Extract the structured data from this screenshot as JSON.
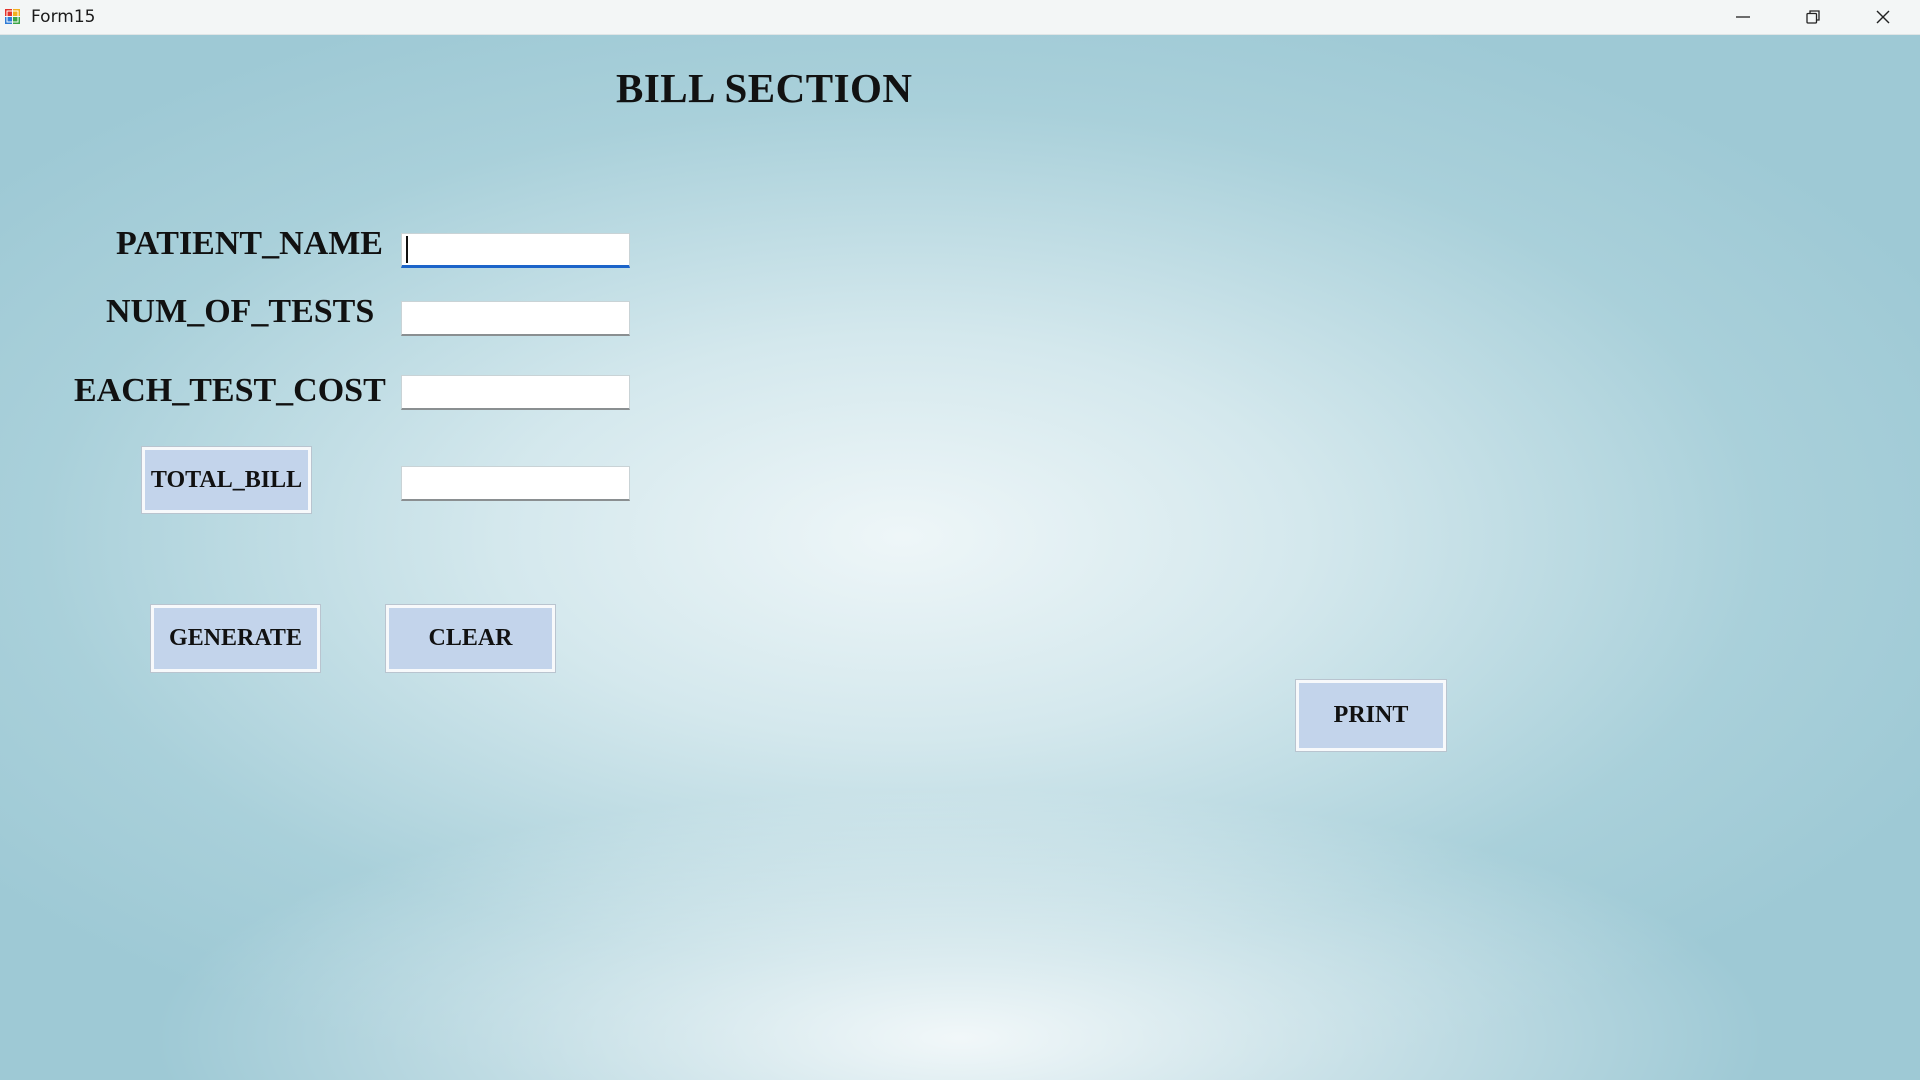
{
  "window": {
    "title": "Form15",
    "controls": [
      "minimize",
      "restore",
      "close"
    ]
  },
  "form": {
    "heading": "BILL SECTION",
    "fields": [
      {
        "label": "PATIENT_NAME",
        "value": "",
        "focused": true
      },
      {
        "label": "NUM_OF_TESTS",
        "value": ""
      },
      {
        "label": "EACH_TEST_COST",
        "value": ""
      }
    ],
    "total_bill": {
      "label": "TOTAL_BILL",
      "value": ""
    },
    "buttons": {
      "generate": "GENERATE",
      "clear": "CLEAR",
      "print": "PRINT"
    }
  },
  "colors": {
    "button_fill": "#c3d4eb",
    "background": "#a9d0da",
    "focus_accent": "#1c64c9"
  },
  "icons": [
    "app-icon",
    "minimize-icon",
    "restore-icon",
    "close-icon"
  ]
}
